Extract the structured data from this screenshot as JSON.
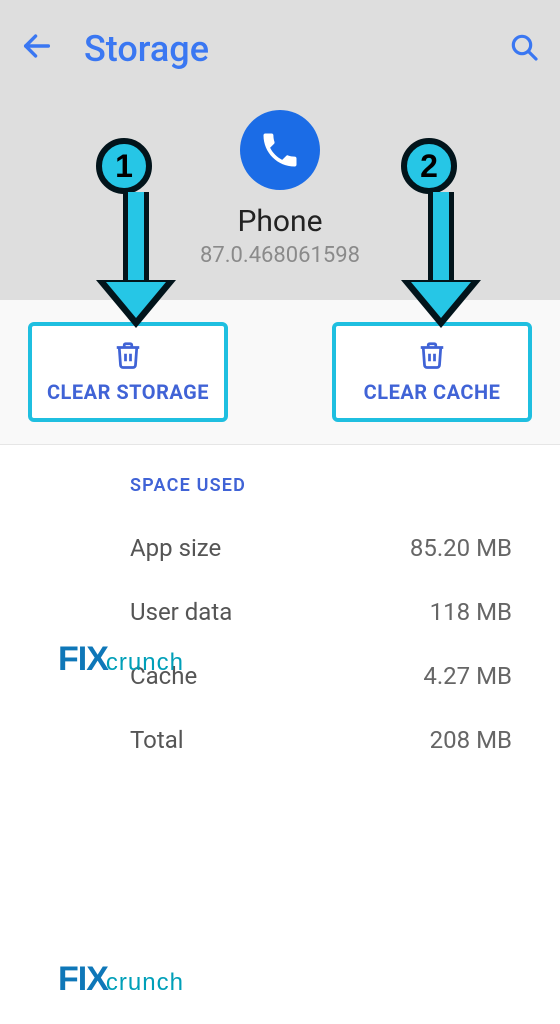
{
  "header": {
    "title": "Storage",
    "app_name": "Phone",
    "app_version": "87.0.468061598"
  },
  "actions": {
    "clear_storage": "CLEAR STORAGE",
    "clear_cache": "CLEAR CACHE"
  },
  "space": {
    "section": "SPACE USED",
    "rows": [
      {
        "label": "App size",
        "value": "85.20 MB"
      },
      {
        "label": "User data",
        "value": "118 MB"
      },
      {
        "label": "Cache",
        "value": "4.27 MB"
      },
      {
        "label": "Total",
        "value": "208 MB"
      }
    ]
  },
  "annotations": {
    "step1": "1",
    "step2": "2"
  },
  "watermark": {
    "brand_a": "FIX",
    "brand_b": "crunch"
  }
}
